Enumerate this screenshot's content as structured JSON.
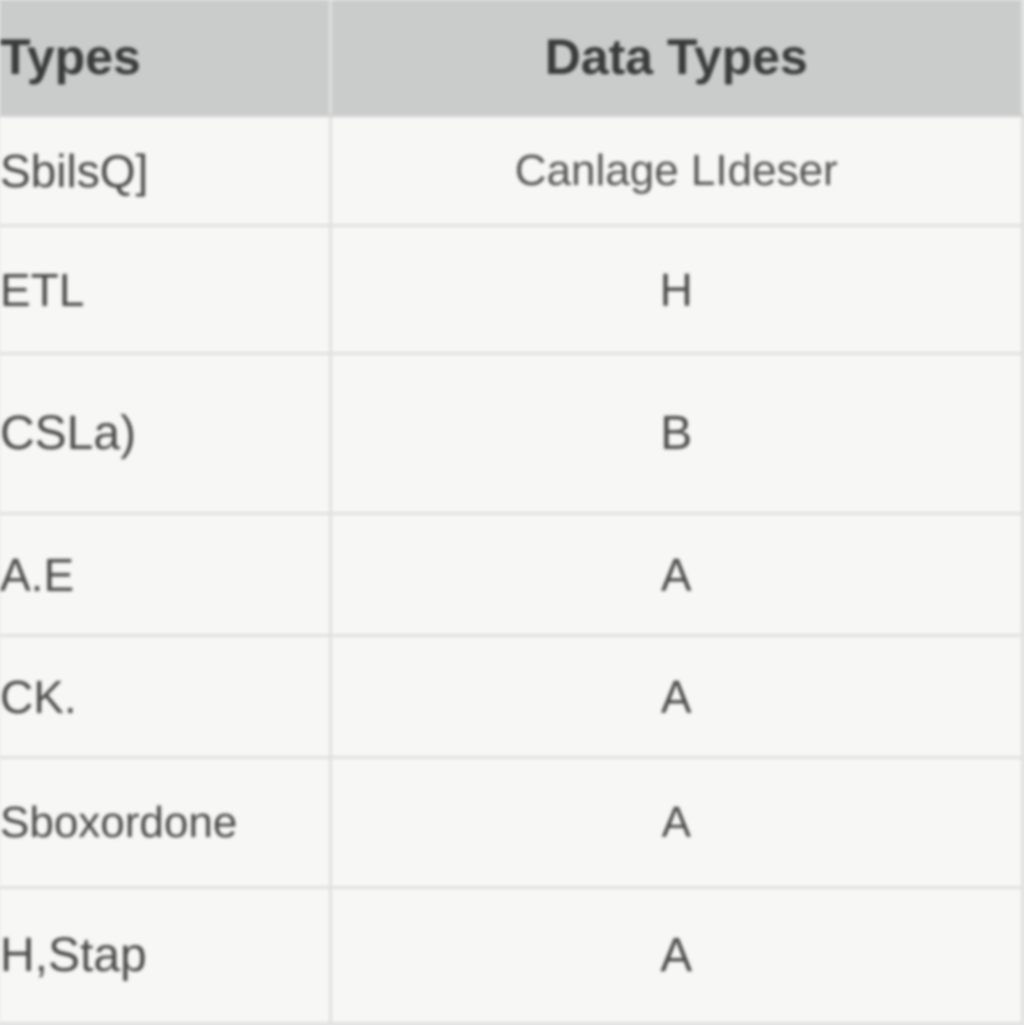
{
  "chart_data": {
    "type": "table",
    "headers": [
      "Types",
      "Data Types"
    ],
    "rows": [
      [
        "SbilsQ]",
        "Canlage LIdeser"
      ],
      [
        "ETL",
        "H"
      ],
      [
        "CSLa)",
        "B"
      ],
      [
        "A.E",
        "A"
      ],
      [
        "CK.",
        "A"
      ],
      [
        "Sboxordone",
        "A"
      ],
      [
        "H,Stap",
        "A"
      ]
    ]
  },
  "headers": {
    "col0": "Types",
    "col1": "Data Types"
  },
  "rows": [
    {
      "types": "SbilsQ]",
      "data_types": "Canlage LIdeser"
    },
    {
      "types": "ETL",
      "data_types": "H"
    },
    {
      "types": "CSLa)",
      "data_types": "B"
    },
    {
      "types": "A.E",
      "data_types": "A"
    },
    {
      "types": "CK.",
      "data_types": "A"
    },
    {
      "types": "Sboxordone",
      "data_types": "A"
    },
    {
      "types": "H,Stap",
      "data_types": "A"
    }
  ]
}
